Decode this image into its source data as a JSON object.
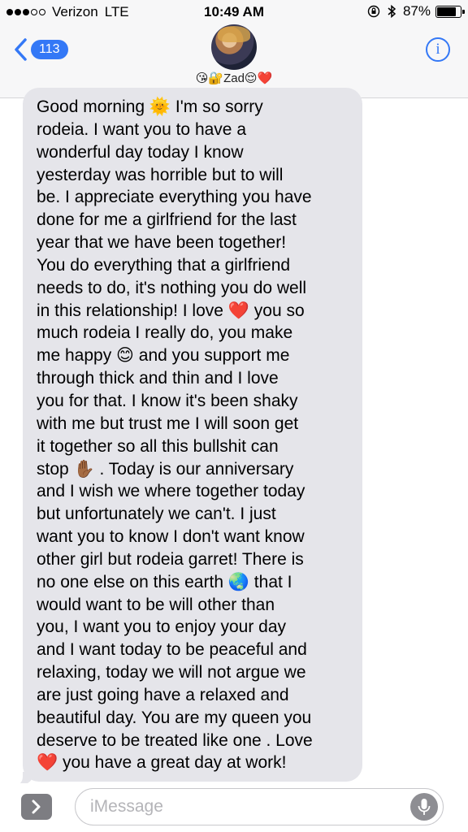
{
  "status_bar": {
    "carrier": "Verizon",
    "network": "LTE",
    "time": "10:49 AM",
    "battery": "87%",
    "battery_level": 0.87
  },
  "header": {
    "back_count": "113",
    "contact_name": "😘🔐Zad😌❤️"
  },
  "message": {
    "lines": [
      "Good morning 🌞  I'm so sorry",
      "rodeia. I want you to have a",
      "wonderful day today I know",
      "yesterday was horrible but to will",
      "be. I appreciate everything you have",
      "done for me a girlfriend for the last",
      "year that we have been together!",
      "You do everything that a girlfriend",
      "needs to do, it's nothing you do well",
      "in this relationship! I love ❤️  you so",
      "much rodeia I really do, you make",
      "me happy 😊  and you support me",
      "through thick and thin and I love",
      "you for that. I know it's been shaky",
      "with me but trust me I will soon get",
      "it together so all this bullshit can",
      "stop ✋🏾 . Today is our anniversary",
      "and I wish we where together today",
      "but unfortunately we can't. I just",
      "want you to know I don't want know",
      "other girl but rodeia garret! There is",
      "no one else on this earth 🌏  that I",
      "would want to be will other than",
      "you, I want you to enjoy your day",
      "and I want today to be peaceful and",
      "relaxing, today we will not argue we",
      "are just going have a relaxed and",
      "beautiful day. You are my queen you",
      "deserve to be treated like one . Love",
      "❤️  you have a great day at work!"
    ]
  },
  "input": {
    "placeholder": "iMessage"
  },
  "colors": {
    "accent": "#3478f6",
    "bubble_received": "#e5e5ea"
  },
  "icons": {
    "back": "chevron-left-icon",
    "info": "info-icon",
    "expand": "chevron-right-icon",
    "mic": "microphone-icon",
    "lock": "lock-rotation-icon",
    "bluetooth": "bluetooth-icon"
  }
}
